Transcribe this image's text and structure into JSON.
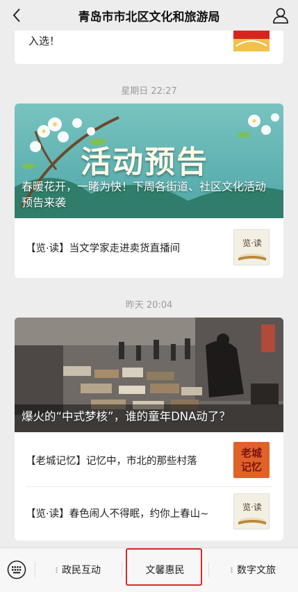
{
  "header": {
    "title": "青岛市市北区文化和旅游局",
    "back_icon": "chevron-left-icon",
    "profile_icon": "person-icon"
  },
  "top_card": {
    "text": "入选！"
  },
  "group1": {
    "time": "星期日 22:27",
    "hero_banner_text": "活动预告",
    "hero_caption": "春暖花开，一睹为快！下周各街道、社区文化活动预告来袭",
    "article": "【览·读】当文学家走进卖货直播间",
    "thumb_text": "览·读"
  },
  "group2": {
    "time": "昨天 20:04",
    "hero_caption": "爆火的“中式梦核”，谁的童年DNA动了？",
    "article1": "【老城记忆】记忆中，市北的那些村落",
    "thumb1_text": "老城记忆",
    "article2": "【览·读】春色闹人不得眠，约你上春山~",
    "thumb2_text": "览·读"
  },
  "tabbar": {
    "keyboard_icon": "keyboard-icon",
    "tabs": [
      "政民互动",
      "文馨惠民",
      "数字文旅"
    ],
    "highlight_color": "#d9282b"
  }
}
